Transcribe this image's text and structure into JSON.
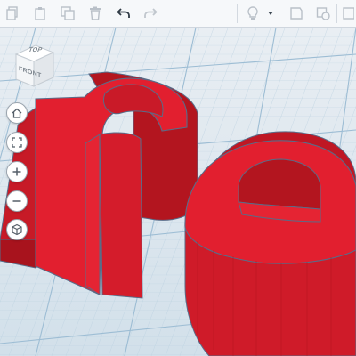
{
  "toolbar": {
    "icons": [
      "copy-icon",
      "paste-icon",
      "duplicate-icon",
      "delete-icon",
      "undo-icon",
      "redo-icon",
      "lightbulb-icon",
      "dropdown-arrow-icon",
      "shape-note-icon",
      "shape-group-icon",
      "panel-icon"
    ]
  },
  "view_cube": {
    "top_label": "TOP",
    "front_label": "FRONT"
  },
  "view_controls": {
    "icons": [
      "home-icon",
      "fit-view-icon",
      "zoom-in-icon",
      "zoom-out-icon",
      "perspective-icon"
    ]
  },
  "colors": {
    "shape_red": "#e21f2f",
    "shape_red_dark": "#b0141f",
    "grid_line": "#a9c6da",
    "grid_bg": "#dfe7ef",
    "edge_outline": "#5a6e8a"
  }
}
